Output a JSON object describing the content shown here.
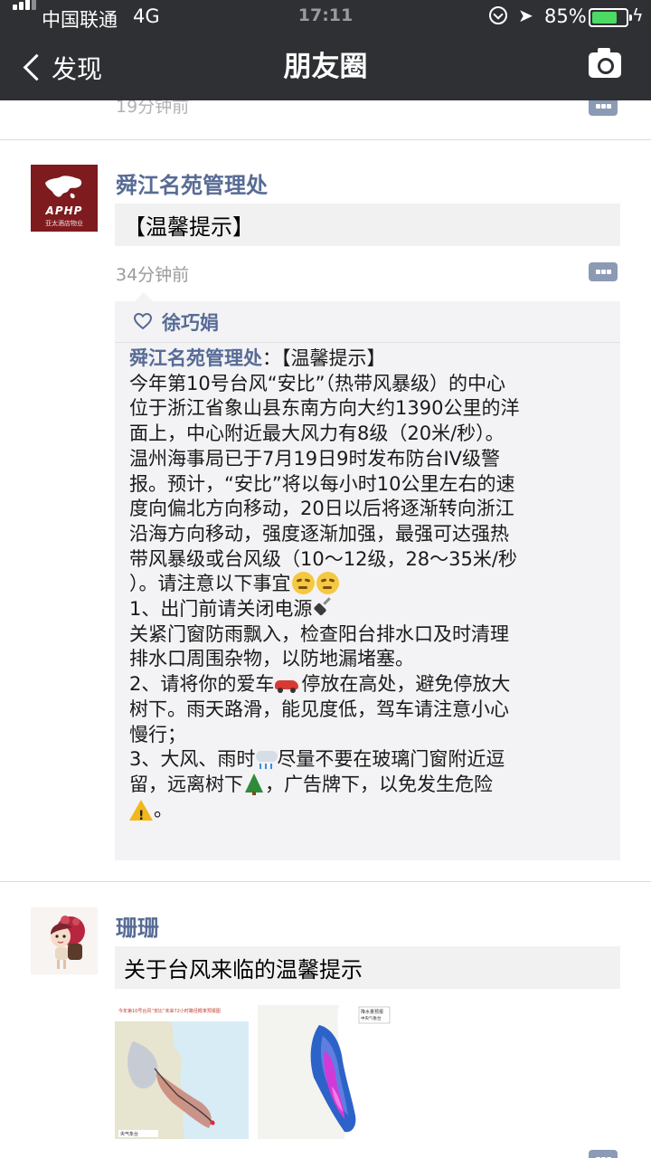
{
  "status_bar": {
    "carrier": "中国联通",
    "network": "4G",
    "time": "17:11",
    "battery_percent": "85%",
    "battery_level": 0.85
  },
  "nav": {
    "back_label": "发现",
    "title": "朋友圈"
  },
  "previous_post": {
    "time": "19分钟前"
  },
  "post1": {
    "author": "舜江名苑管理处",
    "avatar_text": {
      "logo": "APHP",
      "sub": "亚太酒店物业"
    },
    "share_title": "【温馨提示】",
    "time": "34分钟前",
    "liked_by": "徐巧娟",
    "comment": {
      "author": "舜江名苑管理处",
      "lines": [
        "：【温馨提示】",
        "今年第10号台风“安比”（热带风暴级）的中心",
        "位于浙江省象山县东南方向大约1390公里的洋",
        "面上，中心附近最大风力有8级（20米/秒）。",
        "温州海事局已于7月19日9时发布防台IV级警",
        "报。预计，“安比”将以每小时10公里左右的速",
        "度向偏北方向移动，20日以后将逐渐转向浙江",
        "沿海方向移动，强度逐渐加强，最强可达强热",
        "带风暴级或台风级（10～12级，28～35米/秒",
        "）。请注意以下事宜",
        "1、出门前请关闭电源",
        "关紧门窗防雨飘入，检查阳台排水口及时清理",
        "排水口周围杂物，以防地漏堵塞。",
        "2、请将你的爱车",
        "停放在高处，避免停放大",
        "树下。雨天路滑，能见度低，驾车请注意小心",
        "慢行；",
        "3、大风、雨时",
        "尽量不要在玻璃门窗附近逗",
        "留，远离树下",
        "，广告牌下，以免发生危险",
        "。"
      ]
    }
  },
  "post2": {
    "author": "珊珊",
    "share_title": "关于台风来临的温馨提示",
    "images": [
      {
        "caption_top": "今年第10号台风“安比”未来72小时路径概率预报图",
        "caption_bottom": "央气象台"
      },
      {
        "caption_top": "降水量预报",
        "caption_bottom": "中央气象台"
      }
    ]
  }
}
